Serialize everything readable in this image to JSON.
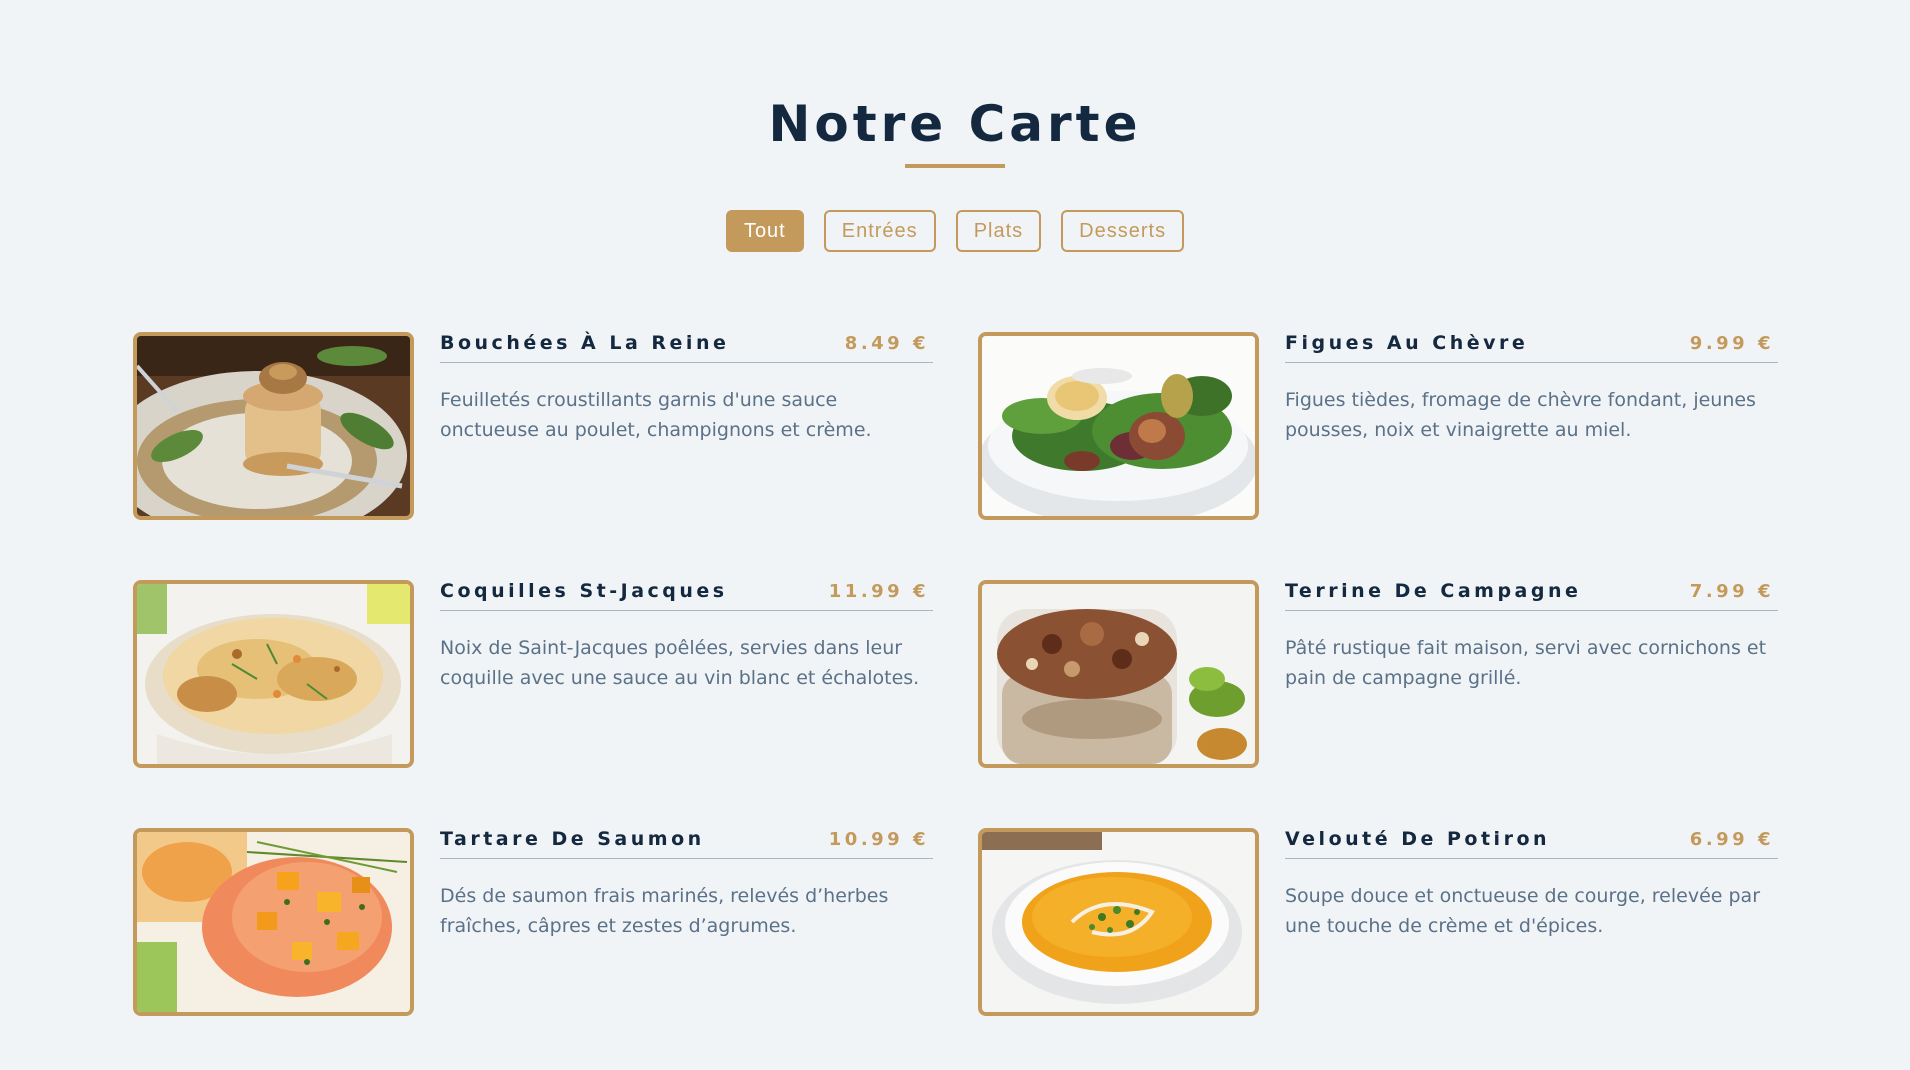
{
  "page": {
    "title": "Notre Carte"
  },
  "filters": [
    {
      "label": "Tout",
      "active": true
    },
    {
      "label": "Entrées",
      "active": false
    },
    {
      "label": "Plats",
      "active": false
    },
    {
      "label": "Desserts",
      "active": false
    }
  ],
  "items": [
    {
      "name": "Bouchées À La Reine",
      "price": "8.49 €",
      "description": "Feuilletés croustillants garnis d'une sauce onctueuse au poulet, champignons et crème.",
      "image_icon": "vol-au-vent-photo"
    },
    {
      "name": "Figues Au Chèvre",
      "price": "9.99 €",
      "description": "Figues tièdes, fromage de chèvre fondant, jeunes pousses, noix et vinaigrette au miel.",
      "image_icon": "goat-cheese-salad-photo"
    },
    {
      "name": "Coquilles St-Jacques",
      "price": "11.99 €",
      "description": "Noix de Saint-Jacques poêlées, servies dans leur coquille avec une sauce au vin blanc et échalotes.",
      "image_icon": "scallop-gratin-photo"
    },
    {
      "name": "Terrine De Campagne",
      "price": "7.99 €",
      "description": "Pâté rustique fait maison, servi avec cornichons et pain de campagne grillé.",
      "image_icon": "terrine-jar-photo"
    },
    {
      "name": "Tartare De Saumon",
      "price": "10.99 €",
      "description": "Dés de saumon frais marinés, relevés d’herbes fraîches, câpres et zestes d’agrumes.",
      "image_icon": "salmon-tartare-photo"
    },
    {
      "name": "Velouté De Potiron",
      "price": "6.99 €",
      "description": "Soupe douce et onctueuse de courge, relevée par une touche de crème et d'épices.",
      "image_icon": "pumpkin-soup-photo"
    }
  ],
  "colors": {
    "accent": "#c49a5c",
    "title": "#14283f",
    "text": "#5b7188",
    "background": "#f1f4f7"
  }
}
